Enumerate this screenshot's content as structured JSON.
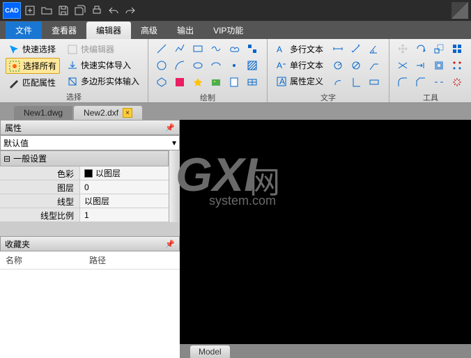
{
  "app": {
    "logo": "CAD"
  },
  "menu": {
    "file": "文件",
    "items": [
      "查看器",
      "编辑器",
      "高级",
      "输出",
      "VIP功能"
    ],
    "active_index": 1
  },
  "ribbon": {
    "select": {
      "quick": "快速选择",
      "all": "选择所有",
      "match": "匹配属性",
      "quick_editor": "快编辑器",
      "quick_import": "快速实体导入",
      "poly_import": "多边形实体输入",
      "label": "选择"
    },
    "draw": {
      "label": "绘制"
    },
    "text": {
      "multi": "多行文本",
      "single": "单行文本",
      "attr": "属性定义",
      "label": "文字"
    },
    "tools": {
      "label": "工具"
    }
  },
  "tabs": [
    {
      "name": "New1.dwg",
      "active": false
    },
    {
      "name": "New2.dxf",
      "active": true
    }
  ],
  "properties": {
    "title": "属性",
    "dropdown": "默认值",
    "group": "一般设置",
    "rows": [
      {
        "k": "色彩",
        "v": "以图层",
        "swatch": true
      },
      {
        "k": "图层",
        "v": "0"
      },
      {
        "k": "线型",
        "v": "以图层"
      },
      {
        "k": "线型比例",
        "v": "1"
      }
    ]
  },
  "favorites": {
    "title": "收藏夹",
    "col1": "名称",
    "col2": "路径"
  },
  "watermark": {
    "big": "GXI",
    "cn": "网",
    "small": "system.com"
  },
  "model_tab": "Model"
}
